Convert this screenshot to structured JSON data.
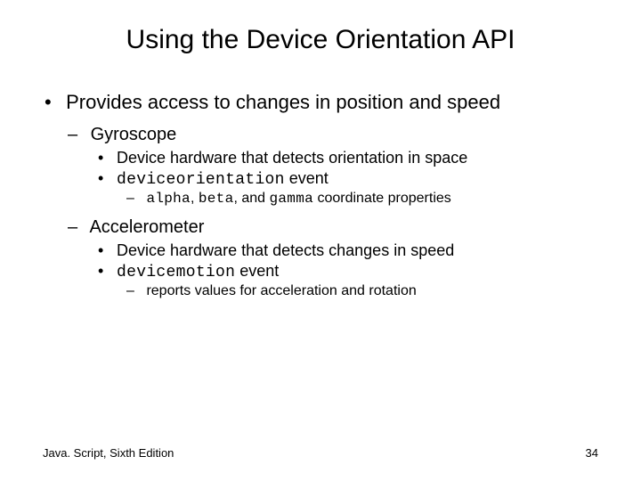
{
  "title": "Using the Device Orientation API",
  "bullets": {
    "a": "Provides access to changes in position and speed",
    "b": "Gyroscope",
    "c": "Device hardware that detects orientation in space",
    "d_pre": "deviceorientation",
    "d_post": " event",
    "e_a": "alpha",
    "e_sep1": ", ",
    "e_b": "beta",
    "e_sep2": ", and ",
    "e_c": "gamma",
    "e_tail": " coordinate properties",
    "f": "Accelerometer",
    "g": "Device hardware that detects changes in speed",
    "h_pre": "devicemotion",
    "h_post": " event",
    "i": "reports values for acceleration and rotation"
  },
  "footer": {
    "left": "Java. Script, Sixth Edition",
    "right": "34"
  }
}
